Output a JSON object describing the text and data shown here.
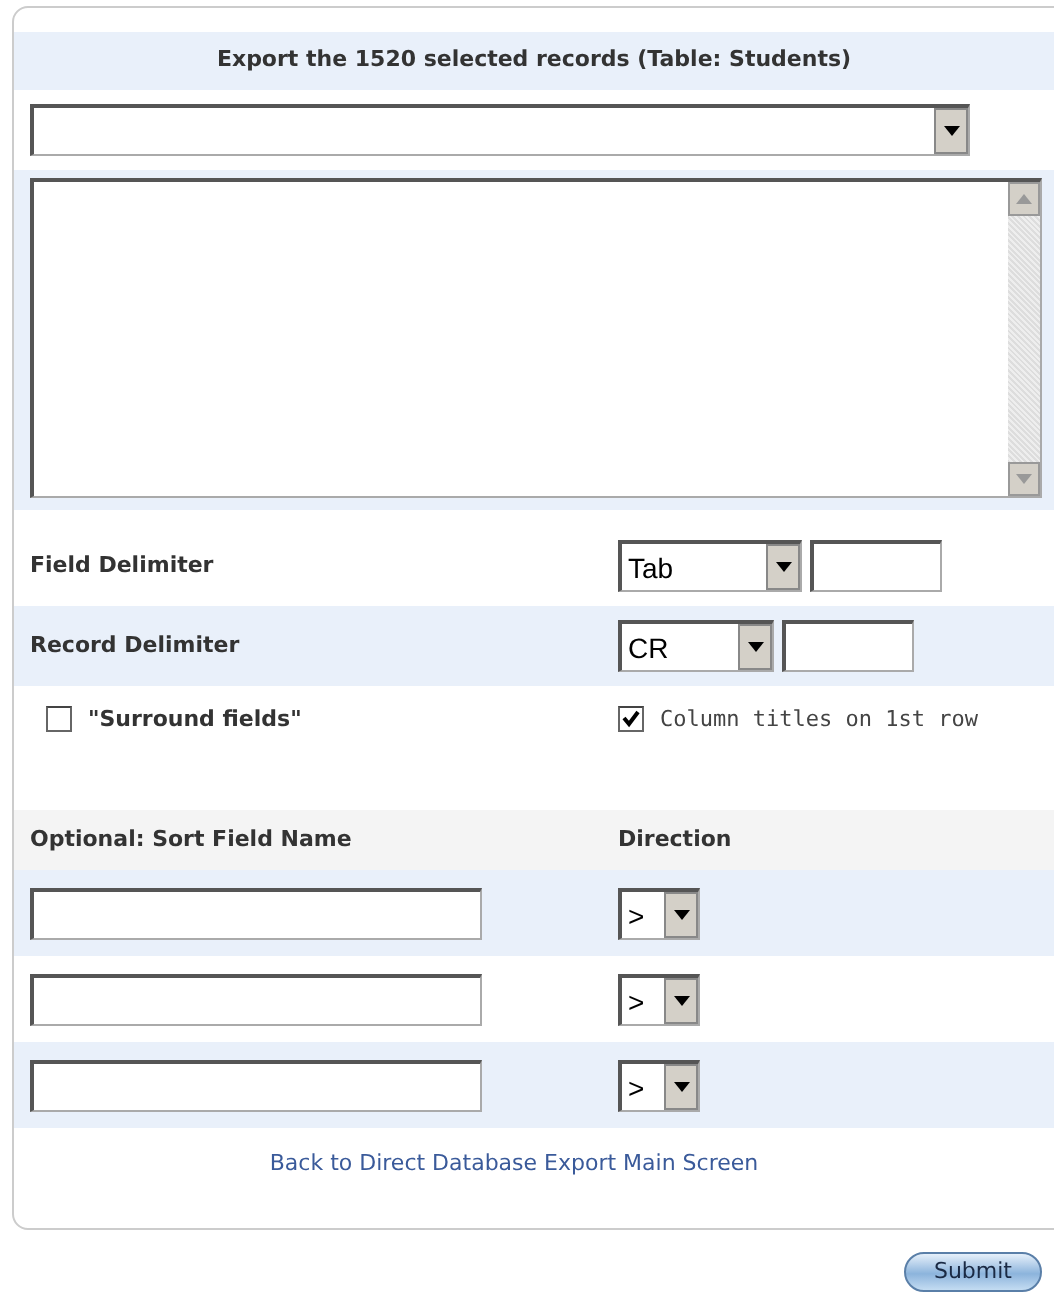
{
  "title": "Export the 1520 selected records (Table: Students)",
  "delimiters": [
    {
      "label": "Field Delimiter",
      "value": "Tab"
    },
    {
      "label": "Record Delimiter",
      "value": "CR"
    }
  ],
  "options": [
    {
      "label": "\"Surround fields\"",
      "checked": false
    },
    {
      "label": "Column titles on 1st row",
      "checked": true
    }
  ],
  "sort": {
    "columns": [
      "Optional: Sort Field Name",
      "Direction"
    ],
    "rows": [
      {
        "direction": ">"
      },
      {
        "direction": ">"
      },
      {
        "direction": ">"
      }
    ]
  },
  "link": "Back to Direct Database Export Main Screen",
  "submit": "Submit"
}
